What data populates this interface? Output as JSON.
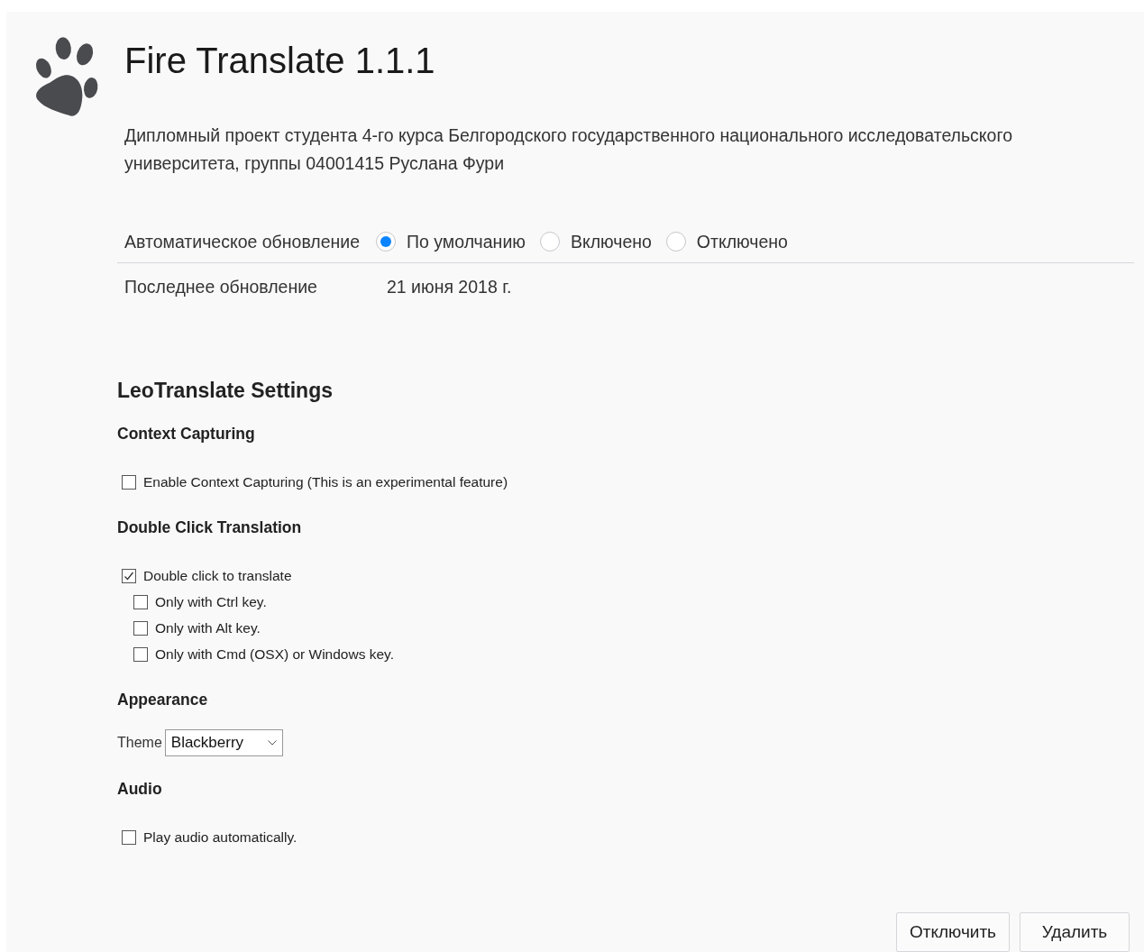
{
  "addon": {
    "title": "Fire Translate 1.1.1",
    "description": "Дипломный проект студента 4-го курса Белгородского государственного национального исследовательского университета, группы 04001415 Руслана Фури"
  },
  "auto_update": {
    "label": "Автоматическое обновление",
    "options": [
      {
        "label": "По умолчанию",
        "selected": true
      },
      {
        "label": "Включено",
        "selected": false
      },
      {
        "label": "Отключено",
        "selected": false
      }
    ]
  },
  "last_update": {
    "label": "Последнее обновление",
    "value": "21 июня 2018 г."
  },
  "settings": {
    "title": "LeoTranslate Settings",
    "sections": [
      {
        "heading": "Context Capturing",
        "items": [
          {
            "kind": "checkbox",
            "label": "Enable Context Capturing (This is an experimental feature)",
            "checked": false
          }
        ]
      },
      {
        "heading": "Double Click Translation",
        "items": [
          {
            "kind": "checkbox",
            "label": "Double click to translate",
            "checked": true,
            "children": [
              {
                "kind": "checkbox",
                "label": "Only with Ctrl key.",
                "checked": false
              },
              {
                "kind": "checkbox",
                "label": "Only with Alt key.",
                "checked": false
              },
              {
                "kind": "checkbox",
                "label": "Only with Cmd (OSX) or Windows key.",
                "checked": false
              }
            ]
          }
        ]
      },
      {
        "heading": "Appearance",
        "items": [
          {
            "kind": "select",
            "label": "Theme",
            "value": "Blackberry"
          }
        ]
      },
      {
        "heading": "Audio",
        "items": [
          {
            "kind": "checkbox",
            "label": "Play audio automatically.",
            "checked": false
          }
        ]
      }
    ]
  },
  "buttons": [
    "Отключить",
    "Удалить"
  ]
}
